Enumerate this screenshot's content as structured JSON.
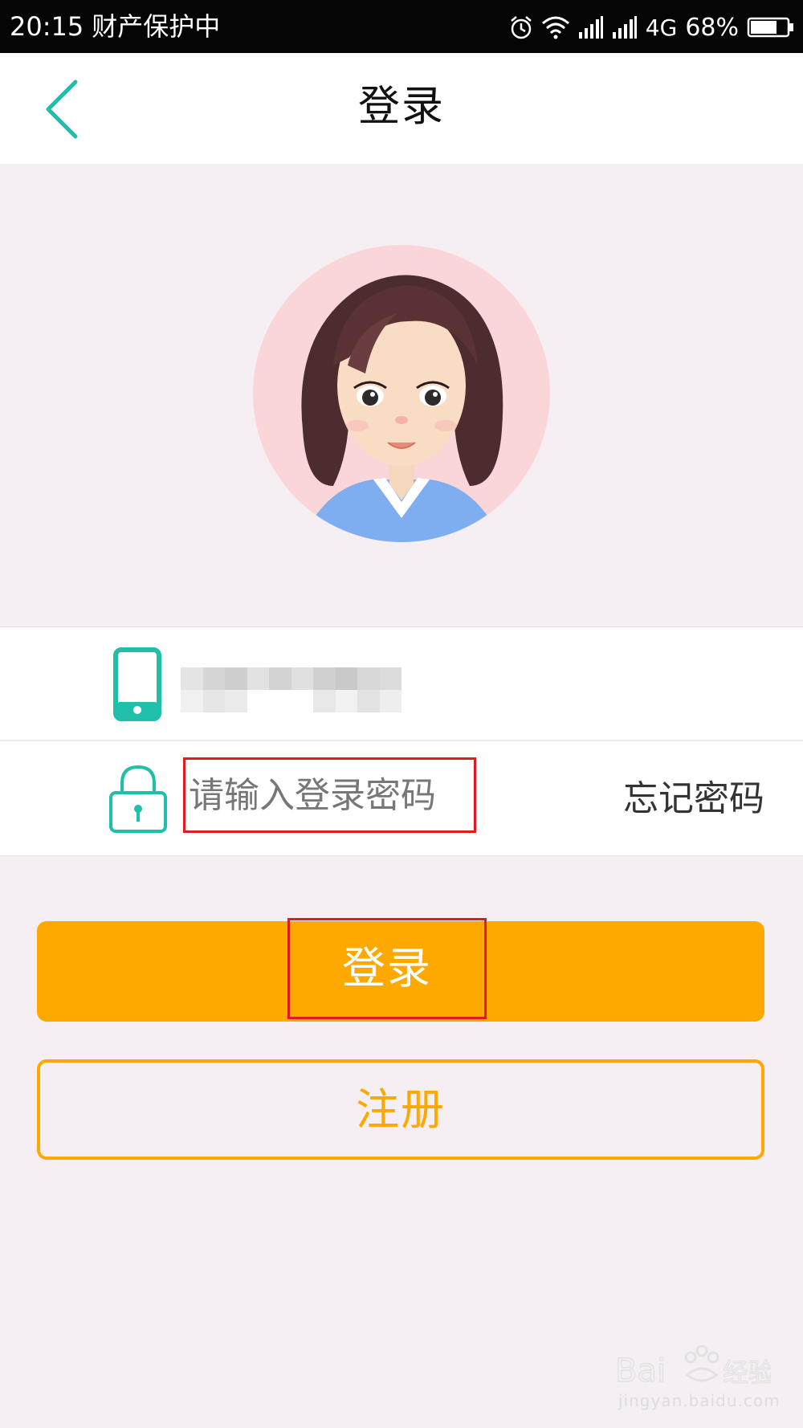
{
  "status_bar": {
    "time": "20:15",
    "notice": "财产保护中",
    "network": "4G",
    "battery": "68%"
  },
  "header": {
    "back_icon": "chevron-left-icon",
    "title": "登录"
  },
  "avatar": {
    "description_icon": "female-cartoon-avatar"
  },
  "form": {
    "phone_icon": "smartphone-icon",
    "phone_value_obscured": true,
    "lock_icon": "lock-icon",
    "password_placeholder": "请输入登录密码",
    "password_value": "",
    "forgot_label": "忘记密码"
  },
  "buttons": {
    "login_label": "登录",
    "register_label": "注册"
  },
  "watermark": {
    "logo": "Bai 经验",
    "url": "jingyan.baidu.com"
  },
  "colors": {
    "accent_teal": "#1fbfaa",
    "primary_orange": "#ffa800",
    "highlight_red": "#e11b22",
    "page_bg": "#f5eff4"
  }
}
